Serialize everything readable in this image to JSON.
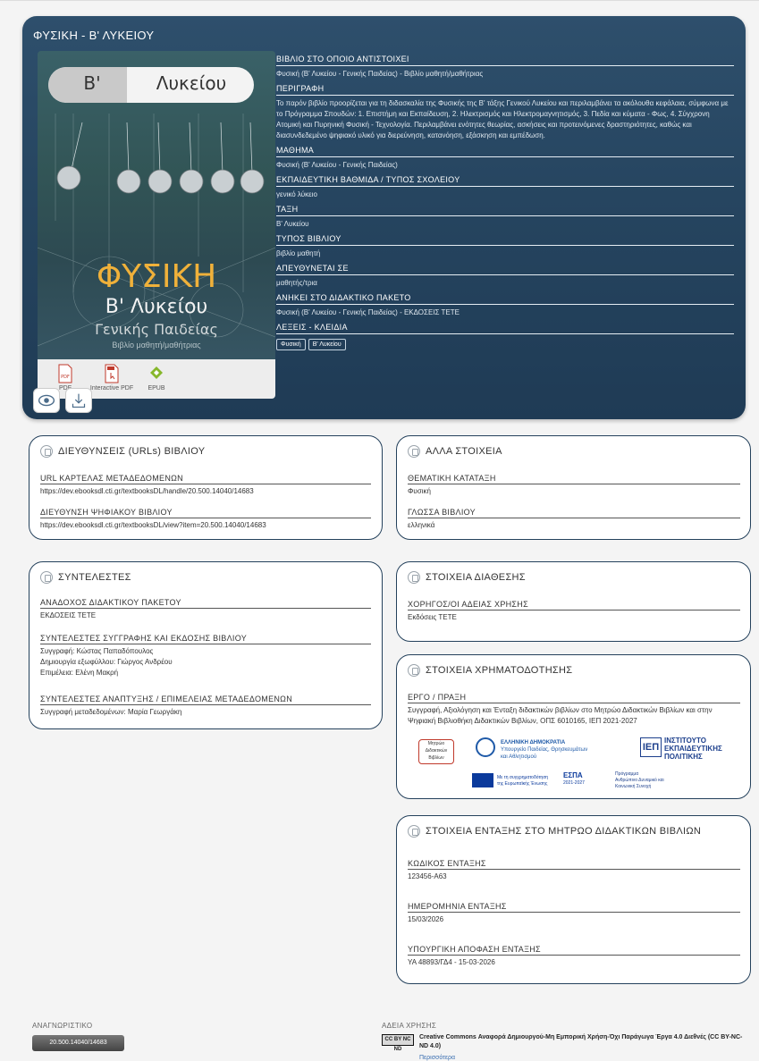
{
  "hero": {
    "title": "ΦΥΣΙΚΗ - Β' ΛΥΚΕΙΟΥ",
    "cover": {
      "grade": "Β'",
      "level": "Λυκείου",
      "name": "ΦΥΣΙΚΗ",
      "sub1": "Β' Λυκείου",
      "sub2": "Γενικής Παιδείας",
      "sub3": "Βιβλίο μαθητή/μαθήτριας",
      "name_color": "#f0b13a"
    },
    "formats": [
      {
        "label": "PDF",
        "icon": "pdf-icon"
      },
      {
        "label": "Interactive PDF",
        "icon": "interactive-pdf-icon"
      },
      {
        "label": "EPUB",
        "icon": "epub-icon"
      }
    ],
    "fields": [
      {
        "label": "ΒΙΒΛΙΟ ΣΤΟ ΟΠΟΙΟ ΑΝΤΙΣΤΟΙΧΕΙ",
        "value": "Φυσική (Β' Λυκείου - Γενικής Παιδείας) - Βιβλίο μαθητή/μαθήτριας"
      },
      {
        "label": "ΠΕΡΙΓΡΑΦΗ",
        "value": "Το παρόν βιβλίο προορίζεται για τη διδασκαλία της Φυσικής της Β' τάξης Γενικού Λυκείου και περιλαμβάνει τα ακόλουθα κεφάλαια, σύμφωνα με το Πρόγραμμα Σπουδών: 1. Επιστήμη και Εκπαίδευση, 2. Ηλεκτρισμός και Ηλεκτρομαγνητισμός, 3. Πεδία και κύματα - Φως, 4. Σύγχρονη Ατομική και Πυρηνική Φυσική - Τεχνολογία. Περιλαμβάνει ενότητες θεωρίας, ασκήσεις και προτεινόμενες δραστηριότητες, καθώς και διασυνδεδεμένο ψηφιακό υλικό για διερεύνηση, κατανόηση, εξάσκηση και εμπέδωση."
      },
      {
        "label": "ΜΑΘΗΜΑ",
        "value": "Φυσική (Β' Λυκείου - Γενικής Παιδείας)"
      },
      {
        "label": "ΕΚΠΑΙΔΕΥΤΙΚΗ ΒΑΘΜΙΔΑ / ΤΥΠΟΣ ΣΧΟΛΕΙΟΥ",
        "value": "γενικό λύκειο"
      },
      {
        "label": "ΤΑΞΗ",
        "value": "Β' Λυκείου"
      },
      {
        "label": "ΤΥΠΟΣ ΒΙΒΛΙΟΥ",
        "value": "βιβλίο μαθητή"
      },
      {
        "label": "ΑΠΕΥΘΥΝΕΤΑΙ ΣΕ",
        "value": "μαθητής/τρια"
      },
      {
        "label": "ΑΝΗΚΕΙ ΣΤΟ ΔΙΔΑΚΤΙΚΟ ΠΑΚΕΤΟ",
        "value": "Φυσική (Β' Λυκείου - Γενικής Παιδείας) - ΕΚΔΟΣΕΙΣ ΤΕΤΕ"
      }
    ],
    "keywords_label": "ΛΕΞΕΙΣ - ΚΛΕΙΔΙΑ",
    "keywords": [
      "Φυσική",
      "Β' Λυκείου"
    ]
  },
  "urls_card": {
    "title": "ΔΙΕΥΘΥΝΣΕΙΣ (URLs) ΒΙΒΛΙΟΥ",
    "fields": [
      {
        "label": "URL ΚΑΡΤΕΛΑΣ ΜΕΤΑΔΕΔΟΜΕΝΩΝ",
        "value": "https://dev.ebooksdl.cti.gr/textbooksDL/handle/20.500.14040/14683"
      },
      {
        "label": "ΔΙΕΥΘΥΝΣΗ ΨΗΦΙΑΚΟΥ ΒΙΒΛΙΟΥ",
        "value": "https://dev.ebooksdl.cti.gr/textbooksDL/view?item=20.500.14040/14683"
      }
    ]
  },
  "other_card": {
    "title": "ΑΛΛΑ ΣΤΟΙΧΕΙΑ",
    "fields": [
      {
        "label": "ΘΕΜΑΤΙΚΗ ΚΑΤΑΤΑΞΗ",
        "value": "Φυσική"
      },
      {
        "label": "ΓΛΩΣΣΑ ΒΙΒΛΙΟΥ",
        "value": "ελληνικά"
      }
    ]
  },
  "contrib_card": {
    "title": "ΣΥΝΤΕΛΕΣΤΕΣ",
    "fields": [
      {
        "label": "ΑΝΑΔΟΧΟΣ ΔΙΔΑΚΤΙΚΟΥ ΠΑΚΕΤΟΥ",
        "lines": [
          "ΕΚΔΟΣΕΙΣ ΤΕΤΕ"
        ]
      },
      {
        "label": "ΣΥΝΤΕΛΕΣΤΕΣ ΣΥΓΓΡΑΦΗΣ ΚΑΙ ΕΚΔΟΣΗΣ ΒΙΒΛΙΟΥ",
        "lines": [
          "Συγγραφή: Κώστας Παπαδόπουλος",
          "Δημιουργία εξωφύλλου: Γιώργος Ανδρέου",
          "Επιμέλεια: Ελένη Μακρή"
        ]
      },
      {
        "label": "ΣΥΝΤΕΛΕΣΤΕΣ ΑΝΑΠΤΥΞΗΣ / ΕΠΙΜΕΛΕΙΑΣ ΜΕΤΑΔΕΔΟΜΕΝΩΝ",
        "lines": [
          "Συγγραφή μεταδεδομένων: Μαρία Γεωργάκη"
        ]
      }
    ]
  },
  "avail_card": {
    "title": "ΣΤΟΙΧΕΙΑ ΔΙΑΘΕΣΗΣ",
    "fields": [
      {
        "label": "ΧΟΡΗΓΟΣ/ΟΙ ΑΔΕΙΑΣ ΧΡΗΣΗΣ",
        "value": "Εκδόσεις ΤΕΤΕ"
      }
    ]
  },
  "funding_card": {
    "title": "ΣΤΟΙΧΕΙΑ ΧΡΗΜΑΤΟΔΟΤΗΣΗΣ",
    "field_label": "ΕΡΓΟ / ΠΡΑΞΗ",
    "field_value": "Συγγραφή, Αξιολόγηση και Ένταξη διδακτικών βιβλίων στο Μητρώο Διδακτικών Βιβλίων και στην Ψηφιακή Βιβλιοθήκη Διδακτικών Βιβλίων, ΟΠΣ 6010165, ΙΕΠ 2021-2027",
    "logos": {
      "mitroo": [
        "Μητρώο",
        "Διδακτικών",
        "Βιβλίων"
      ],
      "greece": [
        "ΕΛΛΗΝΙΚΗ ΔΗΜΟΚΡΑΤΙΑ",
        "Υπουργείο Παιδείας, Θρησκευμάτων",
        "και Αθλητισμού"
      ],
      "iep_abbr": "ΙΕΠ",
      "iep": [
        "ΙΝΣΤΙΤΟΥΤΟ",
        "ΕΚΠΑΙΔΕΥΤΙΚΗΣ",
        "ΠΟΛΙΤΙΚΗΣ"
      ],
      "eu": [
        "Με τη συγχρηματοδότηση",
        "της Ευρωπαϊκής Ένωσης"
      ],
      "espa": "ΕΣΠΑ",
      "espa_years": "2021-2027",
      "program": [
        "Πρόγραμμα",
        "Ανθρώπινο Δυναμικό και",
        "Κοινωνική Συνοχή"
      ]
    },
    "colors": {
      "iep_blue": "#1c3f8c",
      "greece_blue": "#1f5aa8",
      "eu_blue": "#0b3a9c",
      "mitroo_red": "#c0392b"
    }
  },
  "registry_card": {
    "title": "ΣΤΟΙΧΕΙΑ ΕΝΤΑΞΗΣ ΣΤΟ ΜΗΤΡΩΟ ΔΙΔΑΚΤΙΚΩΝ ΒΙΒΛΙΩΝ",
    "fields": [
      {
        "label": "ΚΩΔΙΚΟΣ ΕΝΤΑΞΗΣ",
        "value": "123456-Α63"
      },
      {
        "label": "ΗΜΕΡΟΜΗΝΙΑ ΕΝΤΑΞΗΣ",
        "value": "15/03/2026"
      },
      {
        "label": "ΥΠΟΥΡΓΙΚΗ ΑΠΟΦΑΣΗ ΕΝΤΑΞΗΣ",
        "value": "ΥΑ 48893/ΓΔ4 - 15-03-2026"
      }
    ]
  },
  "footer": {
    "identifier_label": "ΑΝΑΓΝΩΡΙΣΤΙΚΟ",
    "identifier_value": "20.500.14040/14683",
    "license_label": "ΑΔΕΙΑ ΧΡΗΣΗΣ",
    "cc_badge": "CC BY NC ND",
    "license_text": "Creative Commons Αναφορά Δημιουργού-Μη Εμπορική Χρήση-Όχι Παράγωγα Έργα 4.0 Διεθνές (CC BY-NC-ND 4.0)",
    "license_more": "Περισσότερα"
  },
  "theme": {
    "hero_bg": "#264560",
    "card_border": "#24415c",
    "page_bg": "#f4f4f4"
  }
}
